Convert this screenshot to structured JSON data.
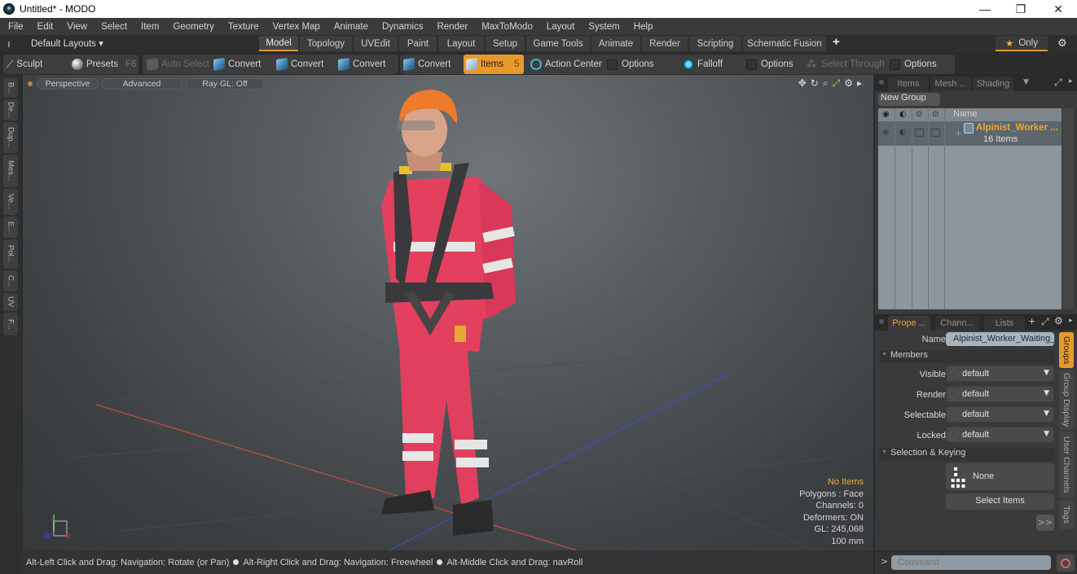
{
  "window": {
    "title": "Untitled* - MODO",
    "controls": {
      "minimize": "—",
      "maximize": "❐",
      "close": "✕"
    }
  },
  "menu": [
    "File",
    "Edit",
    "View",
    "Select",
    "Item",
    "Geometry",
    "Texture",
    "Vertex Map",
    "Animate",
    "Dynamics",
    "Render",
    "MaxToModo",
    "Layout",
    "System",
    "Help"
  ],
  "layout_bar": {
    "layouts_label": "Default Layouts ▾",
    "tabs": [
      "Model",
      "Topology",
      "UVEdit",
      "Paint",
      "Layout",
      "Setup",
      "Game Tools",
      "Animate",
      "Render",
      "Scripting",
      "Schematic Fusion"
    ],
    "active_tab": "Model",
    "add_label": "+",
    "only_label": "Only",
    "only_star": "★"
  },
  "toolbar": {
    "sculpt": "Sculpt",
    "presets": "Presets",
    "presets_key": "F6",
    "auto_select": "Auto Select",
    "convert": [
      "Convert",
      "Convert",
      "Convert",
      "Convert"
    ],
    "items": "Items",
    "items_key": "5",
    "action_center": "Action Center",
    "options_1": "Options",
    "falloff": "Falloff",
    "options_2": "Options",
    "select_through": "Select Through",
    "options_3": "Options"
  },
  "left_tabs": [
    "B...",
    "De...",
    "Dup...",
    "Mes...",
    "Ve...",
    "E...",
    "Pol...",
    "C...",
    "UV",
    "F..."
  ],
  "viewport": {
    "pills": [
      "Perspective",
      "Advanced",
      "Ray GL: Off"
    ],
    "info": {
      "selection": "No Items",
      "polygons": "Polygons : Face",
      "channels": "Channels: 0",
      "deformers": "Deformers: ON",
      "gl": "GL: 245,068",
      "scale": "100 mm"
    },
    "colors": {
      "helmet": "#f07a2c",
      "suit": "#e4405e",
      "reflective": "#e6e6e6",
      "harness": "#3a3a3c",
      "buckle": "#e6c22a"
    }
  },
  "status_bar": {
    "hints": [
      "Alt-Left Click and Drag: Navigation: Rotate (or Pan)",
      "Alt-Right Click and Drag: Navigation: Freewheel",
      "Alt-Middle Click and Drag: navRoll"
    ]
  },
  "items_panel": {
    "tabs": [
      "Items",
      "Mesh ...",
      "Shading"
    ],
    "new_group": "New Group",
    "column_name": "Name",
    "group": {
      "name": "Alpinist_Worker ...",
      "count": "16 Items"
    }
  },
  "properties_panel": {
    "tabs": [
      "Prope ...",
      "Chann...",
      "Lists"
    ],
    "active_tab": "Prope ...",
    "name_label": "Name",
    "name_value": "Alpinist_Worker_Waiting_f",
    "members_section": "Members",
    "fields": [
      {
        "label": "Visible",
        "value": "default"
      },
      {
        "label": "Render",
        "value": "default"
      },
      {
        "label": "Selectable",
        "value": "default"
      },
      {
        "label": "Locked",
        "value": "default"
      }
    ],
    "selection_section": "Selection & Keying",
    "none_button": "None",
    "select_items_button": "Select Items",
    "more_button": ">>",
    "side_tabs": [
      "Groups",
      "Group Display",
      "User Channels",
      "Tags"
    ],
    "active_side_tab": "Groups"
  },
  "command": {
    "prompt": ">",
    "placeholder": "Command"
  }
}
